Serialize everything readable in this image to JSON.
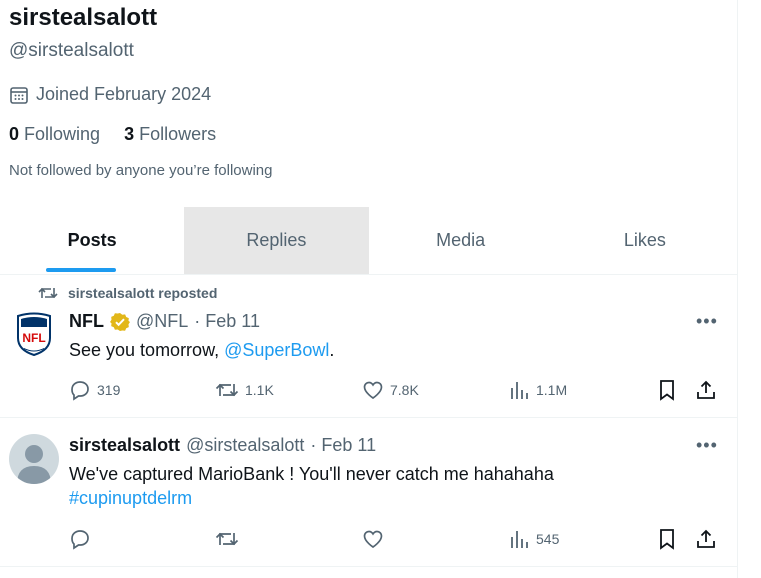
{
  "profile": {
    "display_name": "sirstealsalott",
    "handle": "@sirstealsalott",
    "joined": "Joined February 2024",
    "following_count": "0",
    "following_label": "Following",
    "followers_count": "3",
    "followers_label": "Followers",
    "not_followed": "Not followed by anyone you’re following"
  },
  "tabs": [
    {
      "label": "Posts"
    },
    {
      "label": "Replies"
    },
    {
      "label": "Media"
    },
    {
      "label": "Likes"
    }
  ],
  "posts": [
    {
      "repost_label": "sirstealsalott reposted",
      "author": "NFL",
      "handle": "@NFL",
      "date": "· Feb 11",
      "text_prefix": "See you tomorrow, ",
      "text_link": "@SuperBowl",
      "text_suffix": ".",
      "replies": "319",
      "reposts": "1.1K",
      "likes": "7.8K",
      "views": "1.1M",
      "avatar_text": "NFL",
      "more": "•••"
    },
    {
      "author": "sirstealsalott",
      "handle": "@sirstealsalott",
      "date": "· Feb 11",
      "text": "We've captured MarioBank ! You'll never catch me hahahaha",
      "hashtag": "#cupinuptdelrm",
      "views": "545",
      "more": "•••"
    }
  ],
  "colors": {
    "accent": "#1d9bf0",
    "secondary_text": "#536471",
    "verified_gold": "#e2b719",
    "nfl_blue": "#013369",
    "nfl_red": "#d50a0a"
  }
}
